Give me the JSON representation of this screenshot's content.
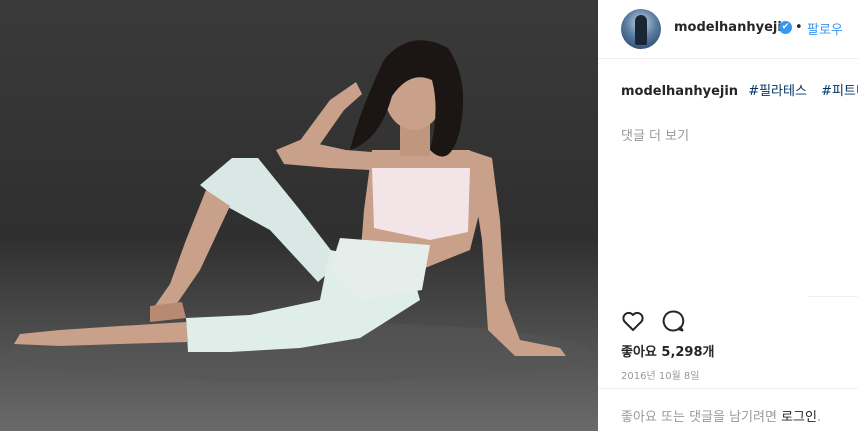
{
  "post": {
    "username": "modelhanhyejin",
    "verified_badge": "✔",
    "separator": "•",
    "follow_label": "팔로우",
    "caption_user": "modelhanhyejin",
    "hashtags": [
      "#필라테스",
      "#피트니"
    ],
    "more_comments_label": "댓글 더 보기",
    "likes_text": "좋아요 5,298개",
    "date_text": "2016년 10월 8일",
    "footer_prefix": "좋아요 또는 댓글을 남기려면",
    "login_label": "로그인",
    "footer_suffix": "."
  },
  "colors": {
    "link": "#3897f0",
    "hashtag": "#003569",
    "muted": "#999999",
    "text": "#262626"
  },
  "icons": {
    "like": "heart-icon",
    "comment": "comment-bubble-icon",
    "verified": "verified-badge-icon"
  }
}
